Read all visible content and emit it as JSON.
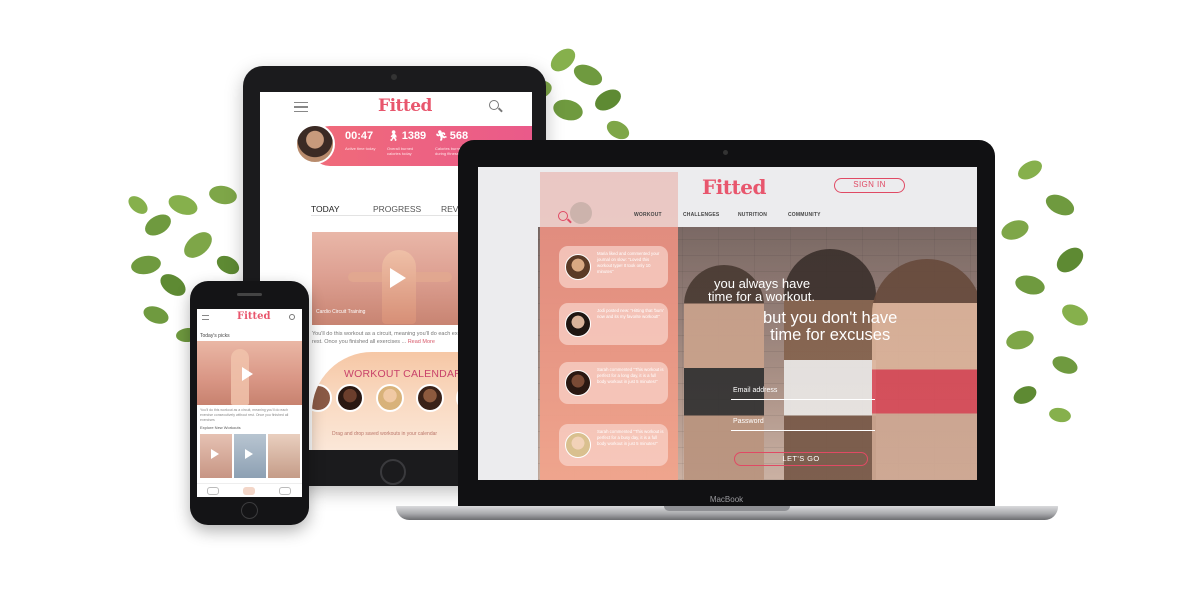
{
  "tablet": {
    "logo": "Fitted",
    "stats": [
      {
        "value": "00:47",
        "sub": "Active time today"
      },
      {
        "value": "1389",
        "sub": "Overall burned calories today"
      },
      {
        "value": "568",
        "sub": "Calories burned during fitness"
      }
    ],
    "tabs": [
      "TODAY",
      "PROGRESS",
      "REV"
    ],
    "video_caption": "Cardio Circuit Training",
    "description": "You'll do this workout as a circuit, meaning you'll do each exercise consecutively without rest. Once you finished all exercises ... ",
    "read_more": "Read More",
    "calendar_title": "WORKOUT CALENDAR",
    "calendar_hint": "Drag and drop saved workouts in your calendar"
  },
  "phone": {
    "logo": "Fitted",
    "todays_picks": "Today's picks",
    "description": "You'll do this workout as a circuit, meaning you'll do each exercise consecutively without rest. Once you finished all exercises",
    "explore": "Explore New Workouts"
  },
  "laptop": {
    "label": "MacBook",
    "logo": "Fitted",
    "sign_in": "SIGN IN",
    "nav": [
      "WORKOUT",
      "CHALLENGES",
      "NUTRITION",
      "COMMUNITY"
    ],
    "cards": [
      {
        "text": "Maria liked and commented your journal on slow: \"Loved this workout type! It took only 10 minutes\""
      },
      {
        "text": "Jodi posted new: \"Hitting that 'bum' now and its my favorite workout!\""
      },
      {
        "text": "Sarah commented \"This workout is perfect for a long day, it is a full body workout in just 5 minutes!\""
      },
      {
        "text": "Sarah commented \"This workout is perfect for a busy day, it is a full body workout in just 5 minutes!\""
      }
    ],
    "tagline1": "you always have time for a workout.",
    "tagline1_line1": "you always have",
    "tagline1_line2": "time for a workout.",
    "tagline2_line1": "but you don't have",
    "tagline2_line2": "time for excuses",
    "email_label": "Email address",
    "password_label": "Password",
    "cta": "LET'S GO"
  },
  "colors": {
    "brand": "#e8566d",
    "accent": "#e04a64",
    "sidebar": "#e99382"
  }
}
